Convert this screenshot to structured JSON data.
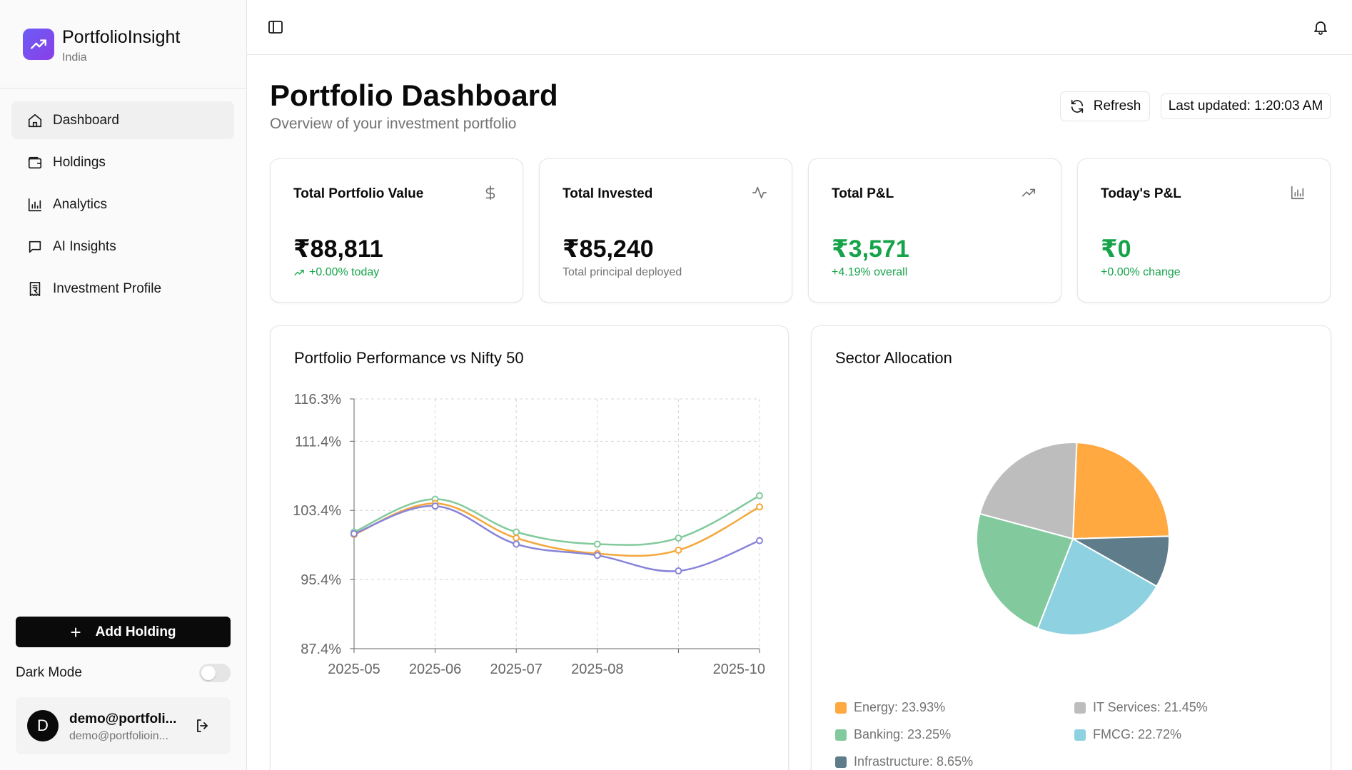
{
  "brand": {
    "name": "PortfolioInsight",
    "region": "India"
  },
  "sidebar": {
    "items": [
      {
        "label": "Dashboard",
        "icon": "home-icon",
        "active": true
      },
      {
        "label": "Holdings",
        "icon": "wallet-icon",
        "active": false
      },
      {
        "label": "Analytics",
        "icon": "bar-chart-icon",
        "active": false
      },
      {
        "label": "AI Insights",
        "icon": "chat-icon",
        "active": false
      },
      {
        "label": "Investment Profile",
        "icon": "receipt-rupee-icon",
        "active": false
      }
    ],
    "add_holding_label": "Add Holding",
    "dark_mode_label": "Dark Mode",
    "dark_mode_on": false,
    "user": {
      "initial": "D",
      "name": "demo@portfoli...",
      "email": "demo@portfolioin..."
    }
  },
  "header": {
    "title": "Portfolio Dashboard",
    "subtitle": "Overview of your investment portfolio",
    "refresh_label": "Refresh",
    "last_updated": "Last updated: 1:20:03 AM"
  },
  "cards": [
    {
      "label": "Total Portfolio Value",
      "icon": "dollar-icon",
      "value": "₹88,811",
      "note": "+0.00% today",
      "value_green": false,
      "note_green": true,
      "note_icon": true
    },
    {
      "label": "Total Invested",
      "icon": "activity-icon",
      "value": "₹85,240",
      "note": "Total principal deployed",
      "value_green": false,
      "note_green": false,
      "note_icon": false
    },
    {
      "label": "Total P&L",
      "icon": "trending-up-icon",
      "value": "₹3,571",
      "note": "+4.19% overall",
      "value_green": true,
      "note_green": true,
      "note_icon": false
    },
    {
      "label": "Today's P&L",
      "icon": "bar-chart-icon",
      "value": "₹0",
      "note": "+0.00% change",
      "value_green": true,
      "note_green": true,
      "note_icon": false
    }
  ],
  "chart_data": [
    {
      "type": "line",
      "title": "Portfolio Performance vs Nifty 50",
      "x_ticks": [
        "2025-05",
        "2025-06",
        "2025-07",
        "2025-08",
        "2025-10"
      ],
      "x": [
        "2025-05",
        "2025-06",
        "2025-07",
        "2025-08",
        "2025-09",
        "2025-10"
      ],
      "y_ticks": [
        "116.3%",
        "111.4%",
        "103.4%",
        "95.4%",
        "87.4%"
      ],
      "ylim": [
        87.4,
        116.3
      ],
      "grid": true,
      "series": [
        {
          "color": "#82ca9d",
          "values": [
            100.9,
            104.7,
            100.9,
            99.5,
            100.2,
            105.1
          ]
        },
        {
          "color": "#f4a73b",
          "values": [
            100.6,
            104.2,
            100.2,
            98.4,
            98.8,
            103.8
          ]
        },
        {
          "color": "#8884d8",
          "values": [
            100.7,
            103.9,
            99.5,
            98.2,
            96.4,
            99.9
          ]
        }
      ]
    },
    {
      "type": "pie",
      "title": "Sector Allocation",
      "slices": [
        {
          "label": "Energy: 23.93%",
          "value": 23.93,
          "color": "#ffa940"
        },
        {
          "label": "Infrastructure: 8.65%",
          "value": 8.65,
          "color": "#5f7c8a"
        },
        {
          "label": "FMCG: 22.72%",
          "value": 22.72,
          "color": "#8ed1e0"
        },
        {
          "label": "Banking: 23.25%",
          "value": 23.25,
          "color": "#82ca9d"
        },
        {
          "label": "IT Services: 21.45%",
          "value": 21.45,
          "color": "#bdbdbd"
        }
      ],
      "legend": [
        {
          "label": "Energy: 23.93%",
          "color": "#ffa940"
        },
        {
          "label": "IT Services: 21.45%",
          "color": "#bdbdbd"
        },
        {
          "label": "Banking: 23.25%",
          "color": "#82ca9d"
        },
        {
          "label": "FMCG: 22.72%",
          "color": "#8ed1e0"
        },
        {
          "label": "Infrastructure: 8.65%",
          "color": "#5f7c8a"
        }
      ]
    }
  ]
}
